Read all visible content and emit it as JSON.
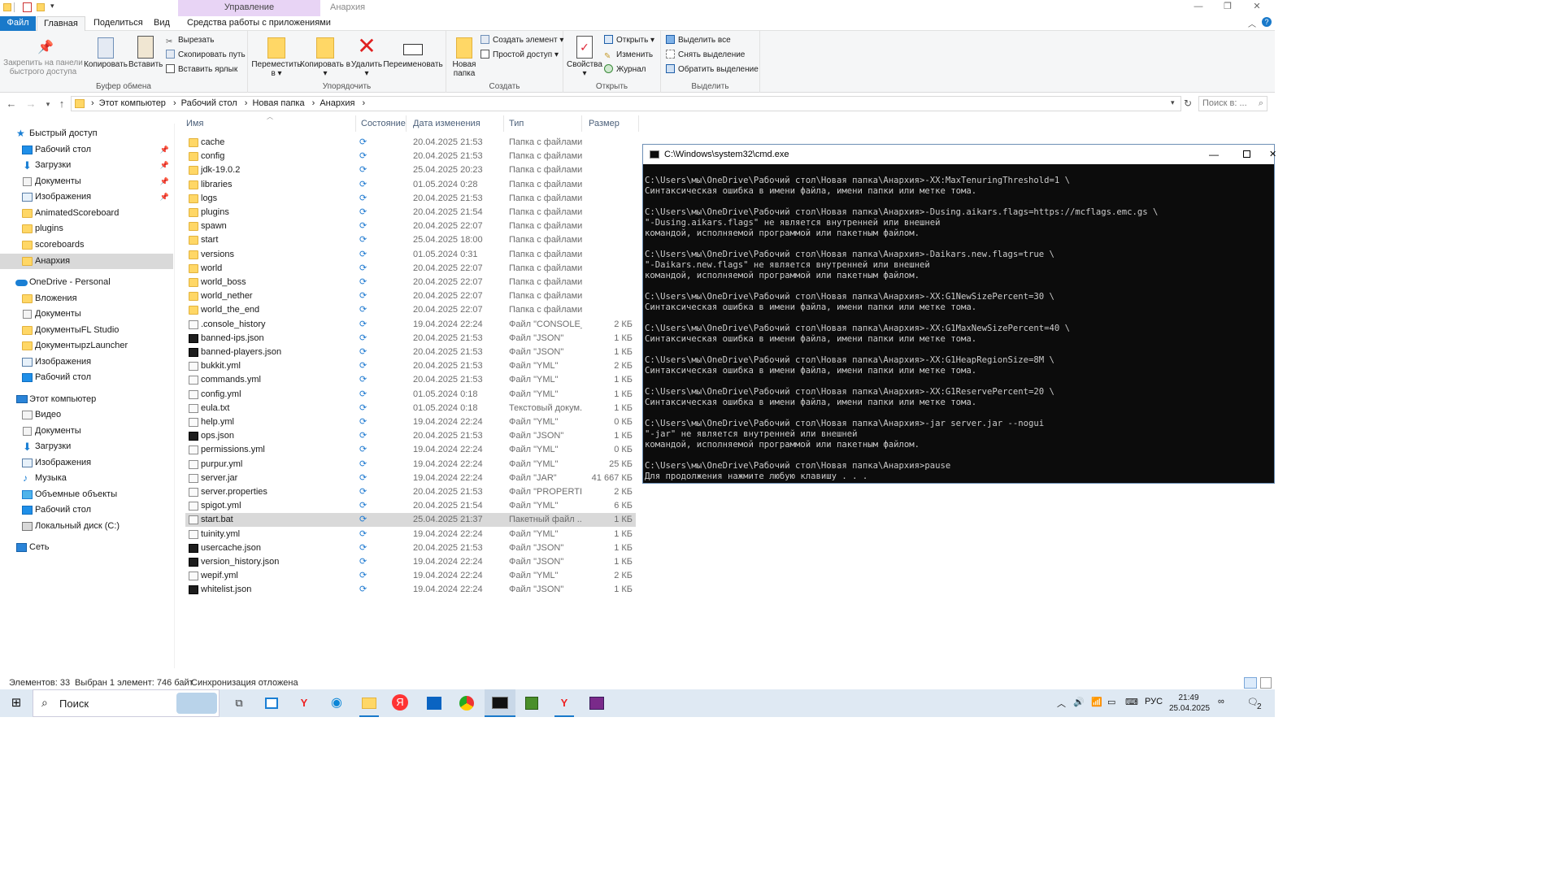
{
  "window": {
    "manage_tab": "Управление",
    "title": "Анархия",
    "controls": {
      "minimize": "—",
      "restore": "❐",
      "close": "✕"
    }
  },
  "ribbon_tabs": {
    "file": "Файл",
    "home": "Главная",
    "share": "Поделиться",
    "view": "Вид",
    "app_tools": "Средства работы с приложениями"
  },
  "ribbon": {
    "clipboard": {
      "label": "Буфер обмена",
      "pin": "Закрепить на панели быстрого доступа",
      "copy": "Копировать",
      "paste": "Вставить",
      "cut": "Вырезать",
      "copy_path": "Скопировать путь",
      "paste_shortcut": "Вставить ярлык"
    },
    "organize": {
      "label": "Упорядочить",
      "move_to": "Переместить в",
      "copy_to": "Копировать в",
      "delete": "Удалить",
      "rename": "Переименовать"
    },
    "create": {
      "label": "Создать",
      "new_folder": "Новая папка",
      "new_item": "Создать элемент",
      "easy_access": "Простой доступ"
    },
    "open": {
      "label": "Открыть",
      "properties": "Свойства",
      "open": "Открыть",
      "edit": "Изменить",
      "history": "Журнал"
    },
    "select": {
      "label": "Выделить",
      "select_all": "Выделить все",
      "select_none": "Снять выделение",
      "invert": "Обратить выделение"
    }
  },
  "address": {
    "path": [
      "Этот компьютер",
      "Рабочий стол",
      "Новая папка",
      "Анархия"
    ],
    "search_placeholder": "Поиск в: ..."
  },
  "nav": {
    "quick_access": "Быстрый доступ",
    "quick_items": [
      "Рабочий стол",
      "Загрузки",
      "Документы",
      "Изображения",
      "AnimatedScoreboard",
      "plugins",
      "scoreboards",
      "Анархия"
    ],
    "onedrive": "OneDrive - Personal",
    "onedrive_items": [
      "Вложения",
      "Документы",
      "ДокументыFL Studio",
      "ДокументыpzLauncher",
      "Изображения",
      "Рабочий стол"
    ],
    "this_pc": "Этот компьютер",
    "pc_items": [
      "Видео",
      "Документы",
      "Загрузки",
      "Изображения",
      "Музыка",
      "Объемные объекты",
      "Рабочий стол",
      "Локальный диск (C:)"
    ],
    "network": "Сеть"
  },
  "columns": {
    "name": "Имя",
    "status": "Состояние",
    "date": "Дата изменения",
    "type": "Тип",
    "size": "Размер"
  },
  "files": [
    {
      "name": "cache",
      "date": "20.04.2025 21:53",
      "type": "Папка с файлами",
      "size": "",
      "kind": "folder"
    },
    {
      "name": "config",
      "date": "20.04.2025 21:53",
      "type": "Папка с файлами",
      "size": "",
      "kind": "folder"
    },
    {
      "name": "jdk-19.0.2",
      "date": "25.04.2025 20:23",
      "type": "Папка с файлами",
      "size": "",
      "kind": "folder"
    },
    {
      "name": "libraries",
      "date": "01.05.2024 0:28",
      "type": "Папка с файлами",
      "size": "",
      "kind": "folder"
    },
    {
      "name": "logs",
      "date": "20.04.2025 21:53",
      "type": "Папка с файлами",
      "size": "",
      "kind": "folder"
    },
    {
      "name": "plugins",
      "date": "20.04.2025 21:54",
      "type": "Папка с файлами",
      "size": "",
      "kind": "folder"
    },
    {
      "name": "spawn",
      "date": "20.04.2025 22:07",
      "type": "Папка с файлами",
      "size": "",
      "kind": "folder"
    },
    {
      "name": "start",
      "date": "25.04.2025 18:00",
      "type": "Папка с файлами",
      "size": "",
      "kind": "folder"
    },
    {
      "name": "versions",
      "date": "01.05.2024 0:31",
      "type": "Папка с файлами",
      "size": "",
      "kind": "folder"
    },
    {
      "name": "world",
      "date": "20.04.2025 22:07",
      "type": "Папка с файлами",
      "size": "",
      "kind": "folder"
    },
    {
      "name": "world_boss",
      "date": "20.04.2025 22:07",
      "type": "Папка с файлами",
      "size": "",
      "kind": "folder"
    },
    {
      "name": "world_nether",
      "date": "20.04.2025 22:07",
      "type": "Папка с файлами",
      "size": "",
      "kind": "folder"
    },
    {
      "name": "world_the_end",
      "date": "20.04.2025 22:07",
      "type": "Папка с файлами",
      "size": "",
      "kind": "folder"
    },
    {
      "name": ".console_history",
      "date": "19.04.2024 22:24",
      "type": "Файл \"CONSOLE_...",
      "size": "2 КБ",
      "kind": "file"
    },
    {
      "name": "banned-ips.json",
      "date": "20.04.2025 21:53",
      "type": "Файл \"JSON\"",
      "size": "1 КБ",
      "kind": "json"
    },
    {
      "name": "banned-players.json",
      "date": "20.04.2025 21:53",
      "type": "Файл \"JSON\"",
      "size": "1 КБ",
      "kind": "json"
    },
    {
      "name": "bukkit.yml",
      "date": "20.04.2025 21:53",
      "type": "Файл \"YML\"",
      "size": "2 КБ",
      "kind": "file"
    },
    {
      "name": "commands.yml",
      "date": "20.04.2025 21:53",
      "type": "Файл \"YML\"",
      "size": "1 КБ",
      "kind": "file"
    },
    {
      "name": "config.yml",
      "date": "01.05.2024 0:18",
      "type": "Файл \"YML\"",
      "size": "1 КБ",
      "kind": "file"
    },
    {
      "name": "eula.txt",
      "date": "01.05.2024 0:18",
      "type": "Текстовый докум...",
      "size": "1 КБ",
      "kind": "file"
    },
    {
      "name": "help.yml",
      "date": "19.04.2024 22:24",
      "type": "Файл \"YML\"",
      "size": "0 КБ",
      "kind": "file"
    },
    {
      "name": "ops.json",
      "date": "20.04.2025 21:53",
      "type": "Файл \"JSON\"",
      "size": "1 КБ",
      "kind": "json"
    },
    {
      "name": "permissions.yml",
      "date": "19.04.2024 22:24",
      "type": "Файл \"YML\"",
      "size": "0 КБ",
      "kind": "file"
    },
    {
      "name": "purpur.yml",
      "date": "19.04.2024 22:24",
      "type": "Файл \"YML\"",
      "size": "25 КБ",
      "kind": "file"
    },
    {
      "name": "server.jar",
      "date": "19.04.2024 22:24",
      "type": "Файл \"JAR\"",
      "size": "41 667 КБ",
      "kind": "file"
    },
    {
      "name": "server.properties",
      "date": "20.04.2025 21:53",
      "type": "Файл \"PROPERTIES\"",
      "size": "2 КБ",
      "kind": "file"
    },
    {
      "name": "spigot.yml",
      "date": "20.04.2025 21:54",
      "type": "Файл \"YML\"",
      "size": "6 КБ",
      "kind": "file"
    },
    {
      "name": "start.bat",
      "date": "25.04.2025 21:37",
      "type": "Пакетный файл ...",
      "size": "1 КБ",
      "kind": "bat",
      "selected": true
    },
    {
      "name": "tuinity.yml",
      "date": "19.04.2024 22:24",
      "type": "Файл \"YML\"",
      "size": "1 КБ",
      "kind": "file"
    },
    {
      "name": "usercache.json",
      "date": "20.04.2025 21:53",
      "type": "Файл \"JSON\"",
      "size": "1 КБ",
      "kind": "json"
    },
    {
      "name": "version_history.json",
      "date": "19.04.2024 22:24",
      "type": "Файл \"JSON\"",
      "size": "1 КБ",
      "kind": "json"
    },
    {
      "name": "wepif.yml",
      "date": "19.04.2024 22:24",
      "type": "Файл \"YML\"",
      "size": "2 КБ",
      "kind": "file"
    },
    {
      "name": "whitelist.json",
      "date": "19.04.2024 22:24",
      "type": "Файл \"JSON\"",
      "size": "1 КБ",
      "kind": "json"
    }
  ],
  "statusbar": {
    "count": "Элементов: 33",
    "selected": "Выбран 1 элемент: 746 байт",
    "sync": "Синхронизация отложена"
  },
  "cmd": {
    "title": "C:\\Windows\\system32\\cmd.exe",
    "lines": [
      "C:\\Users\\мы\\OneDrive\\Рабочий стол\\Новая папка\\Анархия>-XX:MaxTenuringThreshold=1 \\",
      "Синтаксическая ошибка в имени файла, имени папки или метке тома.",
      "",
      "C:\\Users\\мы\\OneDrive\\Рабочий стол\\Новая папка\\Анархия>-Dusing.aikars.flags=https://mcflags.emc.gs \\",
      "\"-Dusing.aikars.flags\" не является внутренней или внешней",
      "командой, исполняемой программой или пакетным файлом.",
      "",
      "C:\\Users\\мы\\OneDrive\\Рабочий стол\\Новая папка\\Анархия>-Daikars.new.flags=true \\",
      "\"-Daikars.new.flags\" не является внутренней или внешней",
      "командой, исполняемой программой или пакетным файлом.",
      "",
      "C:\\Users\\мы\\OneDrive\\Рабочий стол\\Новая папка\\Анархия>-XX:G1NewSizePercent=30 \\",
      "Синтаксическая ошибка в имени файла, имени папки или метке тома.",
      "",
      "C:\\Users\\мы\\OneDrive\\Рабочий стол\\Новая папка\\Анархия>-XX:G1MaxNewSizePercent=40 \\",
      "Синтаксическая ошибка в имени файла, имени папки или метке тома.",
      "",
      "C:\\Users\\мы\\OneDrive\\Рабочий стол\\Новая папка\\Анархия>-XX:G1HeapRegionSize=8M \\",
      "Синтаксическая ошибка в имени файла, имени папки или метке тома.",
      "",
      "C:\\Users\\мы\\OneDrive\\Рабочий стол\\Новая папка\\Анархия>-XX:G1ReservePercent=20 \\",
      "Синтаксическая ошибка в имени файла, имени папки или метке тома.",
      "",
      "C:\\Users\\мы\\OneDrive\\Рабочий стол\\Новая папка\\Анархия>-jar server.jar --nogui",
      "\"-jar\" не является внутренней или внешней",
      "командой, исполняемой программой или пакетным файлом.",
      "",
      "C:\\Users\\мы\\OneDrive\\Рабочий стол\\Новая папка\\Анархия>pause",
      "Для продолжения нажмите любую клавишу . . ."
    ]
  },
  "taskbar": {
    "search": "Поиск",
    "lang": "РУС",
    "time": "21:49",
    "date": "25.04.2025",
    "notifications": "2"
  },
  "colors": {
    "accent": "#1979ca",
    "folder": "#ffd766",
    "selected_row": "#d9d9d9",
    "sync": "#1f7ad1",
    "taskbar": "#dfe9f3"
  }
}
